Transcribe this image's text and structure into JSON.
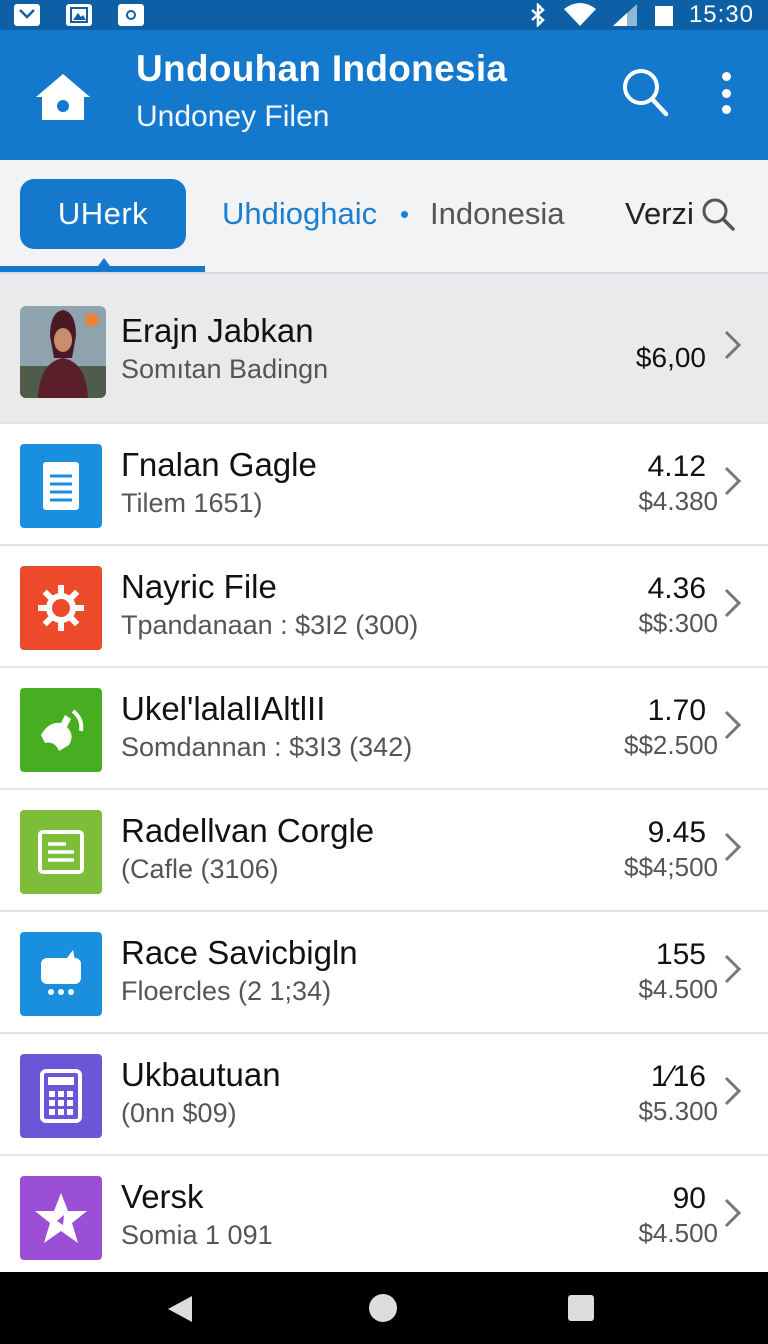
{
  "status_bar": {
    "time": "15:30",
    "left_icons": [
      "mail-icon",
      "image-icon",
      "camera-icon"
    ],
    "right_icons": [
      "bluetooth-icon",
      "wifi-icon",
      "signal-icon",
      "battery-icon"
    ]
  },
  "app_bar": {
    "title": "Undouhan Indonesia",
    "subtitle": "Undoney Filen",
    "color": "#1478cc"
  },
  "tabs": {
    "active": "UHerk",
    "items": [
      "Uhdioghaic",
      "Indonesia",
      "Verzi"
    ]
  },
  "list": {
    "featured": {
      "name": "Erajn Jabkan",
      "sub": "Somıtan Badingn",
      "price": "$6,00"
    },
    "items": [
      {
        "name": "Гnalan Gagle",
        "sub": "Tilem 1651)",
        "val1": "4.12",
        "val2": "$4.380",
        "icon": "document-icon",
        "color": "#1a8fe0"
      },
      {
        "name": "Nayric File",
        "sub": "Tpandanaan : $3I2 (300)",
        "val1": "4.36",
        "val2": "$$:300",
        "icon": "gear-icon",
        "color": "#ec4a2a"
      },
      {
        "name": "Ukel'lalalIAltlII",
        "sub": "Somdannan : $3I3 (342)",
        "val1": "1.70",
        "val2": "$$2.500",
        "icon": "hands-icon",
        "color": "#47ae22"
      },
      {
        "name": "Radellvan Corgle",
        "sub": "(Cafle (3106)",
        "val1": "9.45",
        "val2": "$$4;500",
        "icon": "notes-icon",
        "color": "#7cbe3a"
      },
      {
        "name": "Race Savicbigln",
        "sub": "Floercles (2 1;34)",
        "val1": "155",
        "val2": "$4.500",
        "icon": "chat-icon",
        "color": "#1a8fe0"
      },
      {
        "name": "Ukbautuan",
        "sub": "(0nn $09)",
        "val1": "1⁄16",
        "val2": "$5.300",
        "icon": "calculator-icon",
        "color": "#6d55d8"
      },
      {
        "name": "Versk",
        "sub": "Somia 1 091",
        "val1": "90",
        "val2": "$4.500",
        "icon": "star-icon",
        "color": "#9b4ed6"
      }
    ]
  }
}
